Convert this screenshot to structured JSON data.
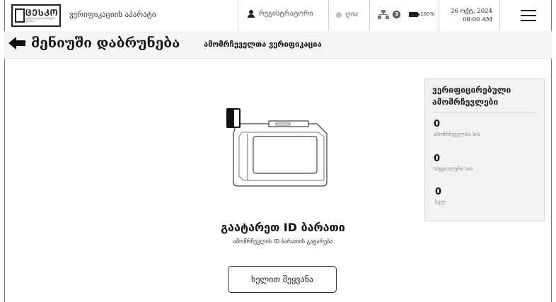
{
  "header": {
    "logo_text": "ᲪᲔᲡᲙᲝ",
    "logo_subtext": "ცენტრალური საარჩევნო კომისია",
    "app_name": "ვერიფიკაციის აპარატი",
    "registrar_label": "რეგისტრატორი",
    "online_label": "ღია",
    "network_badge": "3",
    "battery_label": "100%",
    "date": "26 ოქტ, 2024",
    "time": "08:00 AM"
  },
  "subbar": {
    "back_label": "მენიუში დაბრუნება",
    "page_subtitle": "ამომრჩეველთა ვერიფიკაცია"
  },
  "stats_card": {
    "title": "ვერიფიცირებული ამომრჩევლები",
    "items": [
      {
        "value": "0",
        "caption": "ამომრჩეველთა სია"
      },
      {
        "value": "0",
        "caption": "სპეციალური სია"
      },
      {
        "value": "0",
        "caption": "სულ"
      }
    ]
  },
  "main": {
    "title": "გაატარეთ ID ბარათი",
    "subtitle": "ამომრჩევლის ID ბარათის გატარება",
    "manual_button": "ხელით შეყვანა"
  },
  "icons": {
    "person": "person-icon",
    "back": "back-arrow-icon",
    "menu": "hamburger-menu-icon",
    "network": "network-icon",
    "battery": "battery-icon"
  },
  "colors": {
    "accent": "#111111",
    "card_bg": "#f2f2f2",
    "online_dot": "#bdbdbd"
  }
}
